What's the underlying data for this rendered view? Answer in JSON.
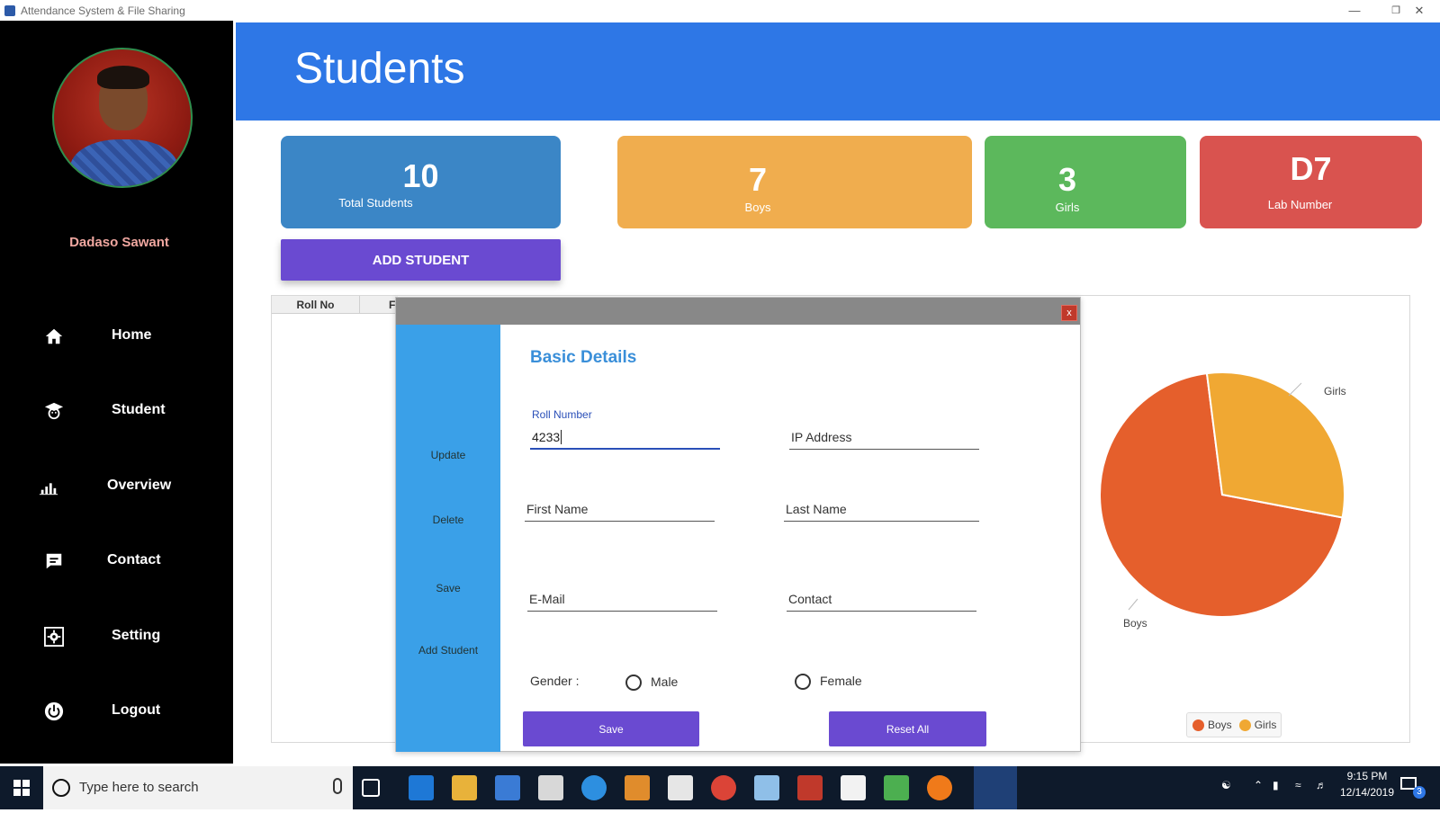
{
  "window": {
    "title": "Attendance System & File Sharing",
    "minimize": "—",
    "restore": "❐",
    "close": "✕"
  },
  "sidebar": {
    "user_name": "Dadaso Sawant",
    "items": [
      {
        "label": "Home",
        "icon": "home-icon"
      },
      {
        "label": "Student",
        "icon": "student-icon"
      },
      {
        "label": "Overview",
        "icon": "chart-icon"
      },
      {
        "label": "Contact",
        "icon": "chat-icon"
      },
      {
        "label": "Setting",
        "icon": "gear-icon"
      },
      {
        "label": "Logout",
        "icon": "power-icon"
      }
    ]
  },
  "header": {
    "title": "Students"
  },
  "cards": {
    "total": {
      "value": "10",
      "label": "Total Students",
      "color": "#3b86c6"
    },
    "boys": {
      "value": "7",
      "label": "Boys",
      "color": "#f0ad4e"
    },
    "girls": {
      "value": "3",
      "label": "Girls",
      "color": "#5cb85c"
    },
    "lab": {
      "value": "D7",
      "label": "Lab Number",
      "color": "#d9534f"
    }
  },
  "add_student_label": "ADD STUDENT",
  "grid": {
    "columns": [
      "Roll No",
      "F"
    ]
  },
  "chart_data": {
    "type": "pie",
    "categories": [
      "Boys",
      "Girls"
    ],
    "values": [
      7,
      3
    ],
    "colors": [
      "#e55f2c",
      "#f0a833"
    ],
    "legend": [
      "Boys",
      "Girls"
    ],
    "legend_position": "bottom"
  },
  "dialog": {
    "close_label": "x",
    "side_links": [
      "Update",
      "Delete",
      "Save",
      "Add Student"
    ],
    "section_title": "Basic Details",
    "fields": {
      "roll_label": "Roll Number",
      "roll_value": "4233",
      "ip": "IP Address",
      "first_name": "First Name",
      "last_name": "Last Name",
      "email": "E-Mail",
      "contact": "Contact"
    },
    "gender_label": "Gender  :",
    "gender_options": [
      "Male",
      "Female"
    ],
    "save_label": "Save",
    "reset_label": "Reset All"
  },
  "taskbar": {
    "search_placeholder": "Type here to search",
    "time": "9:15 PM",
    "date": "12/14/2019",
    "notification_count": "3"
  }
}
